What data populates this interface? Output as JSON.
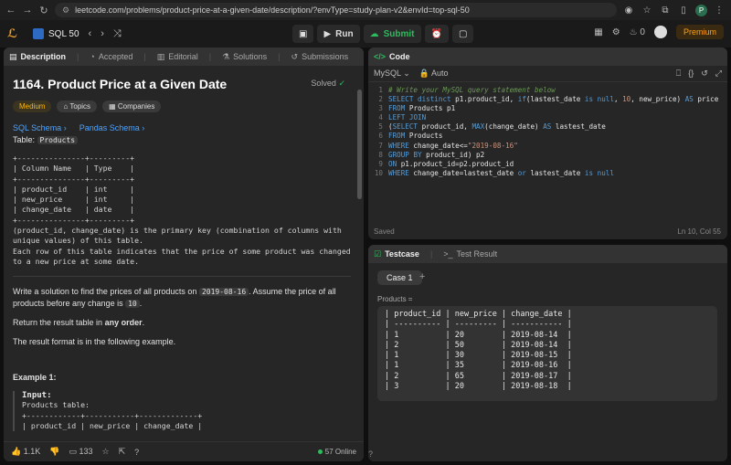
{
  "browser": {
    "url": "leetcode.com/problems/product-price-at-a-given-date/description/?envType=study-plan-v2&envId=top-sql-50",
    "profile_initial": "P"
  },
  "header": {
    "study_plan": "SQL 50",
    "run_label": "Run",
    "submit_label": "Submit",
    "streak_count": "0",
    "premium_label": "Premium"
  },
  "left_tabs": [
    "Description",
    "Accepted",
    "Editorial",
    "Solutions",
    "Submissions"
  ],
  "problem": {
    "title": "1164. Product Price at a Given Date",
    "status": "Solved",
    "difficulty": "Medium",
    "topics_label": "Topics",
    "companies_label": "Companies",
    "schema_links": [
      "SQL Schema",
      "Pandas Schema"
    ],
    "table_label": "Table:",
    "table_name": "Products",
    "schema_block": "+---------------+---------+\n| Column Name   | Type    |\n+---------------+---------+\n| product_id    | int     |\n| new_price     | int     |\n| change_date   | date    |\n+---------------+---------+",
    "schema_note": "(product_id, change_date) is the primary key (combination of columns with\nunique values) of this table.\nEach row of this table indicates that the price of some product was changed\nto a new price at some date.",
    "prompt_pre": "Write a solution to find the prices of all products on",
    "prompt_date": "2019-08-16",
    "prompt_mid": ". Assume the price of all products before any change is",
    "prompt_ten": "10",
    "prompt_end": ".",
    "return_pre": "Return the result table in",
    "return_bold": "any order",
    "return_end": ".",
    "format_text": "The result format is in the following example.",
    "example_title": "Example 1:",
    "input_label": "Input:",
    "example_block": "Products table:\n+------------+-----------+-------------+\n| product_id | new_price | change_date |"
  },
  "footer": {
    "likes": "1.1K",
    "comments": "133",
    "online": "57 Online"
  },
  "code_panel": {
    "title": "Code",
    "language": "MySQL",
    "mode": "Auto",
    "saved": "Saved",
    "cursor": "Ln 10, Col 55"
  },
  "test_panel": {
    "tab1": "Testcase",
    "tab2": "Test Result",
    "case_label": "Case 1",
    "input_name": "Products =",
    "table_text": "| product_id | new_price | change_date |\n| ---------- | --------- | ----------- |\n| 1          | 20        | 2019-08-14  |\n| 2          | 50        | 2019-08-14  |\n| 1          | 30        | 2019-08-15  |\n| 1          | 35        | 2019-08-16  |\n| 2          | 65        | 2019-08-17  |\n| 3          | 20        | 2019-08-18  |"
  },
  "code_lines": [
    "# Write your MySQL query statement below",
    "SELECT distinct p1.product_id, if(lastest_date is null, 10, new_price) AS price",
    "FROM Products p1",
    "LEFT JOIN",
    "(SELECT product_id, MAX(change_date) AS lastest_date",
    "FROM Products",
    "WHERE change_date<=\"2019-08-16\"",
    "GROUP BY product_id) p2",
    "ON p1.product_id=p2.product_id",
    "WHERE change_date=lastest_date or lastest_date is null"
  ]
}
